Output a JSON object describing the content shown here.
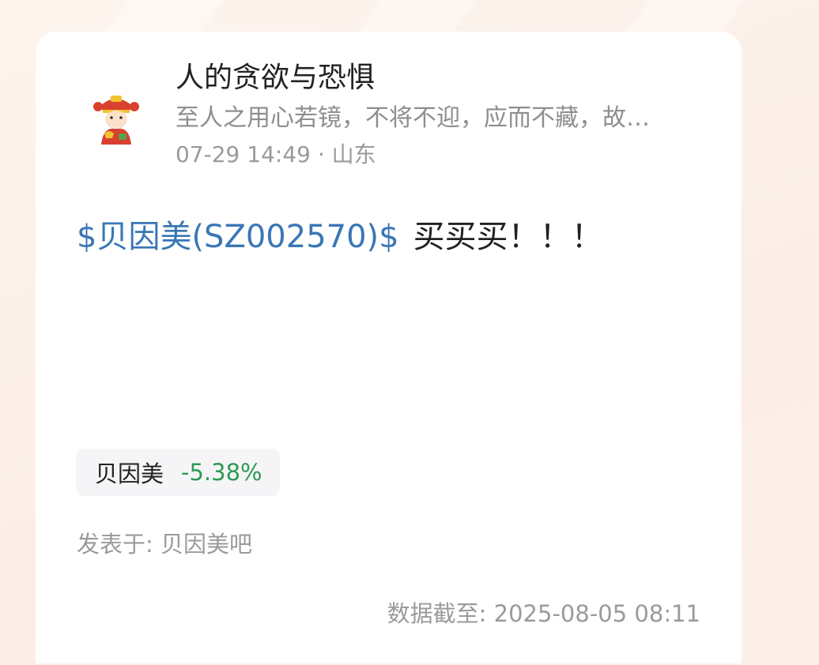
{
  "post": {
    "author": {
      "name": "人的贪欲与恐惧",
      "signature": "至人之用心若镜，不将不迎，应而不藏，故…",
      "avatar_icon": "caishen-avatar-icon"
    },
    "time": "07-29 14:49",
    "separator": "·",
    "location": "山东",
    "stock_mention": "$贝因美(SZ002570)$",
    "content": "买买买！！！"
  },
  "stock_tag": {
    "name": "贝因美",
    "change": "-5.38%",
    "change_color": "#2e9a52"
  },
  "posted_in": "发表于: 贝因美吧",
  "data_time": "数据截至: 2025-08-05 08:11",
  "colors": {
    "link": "#3a76b5",
    "text": "#222222",
    "muted": "#9a9a9a",
    "background": "#fdf4ee"
  }
}
